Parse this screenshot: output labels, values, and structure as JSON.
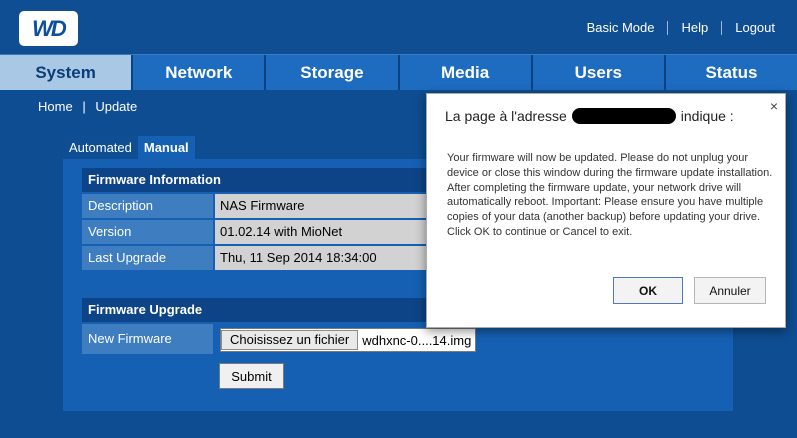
{
  "header": {
    "logo_text": "WD",
    "links": [
      "Basic Mode",
      "Help",
      "Logout"
    ]
  },
  "nav": {
    "tabs": [
      "System",
      "Network",
      "Storage",
      "Media",
      "Users",
      "Status"
    ],
    "active": "System"
  },
  "breadcrumb": {
    "home": "Home",
    "separator": "|",
    "current": "Update"
  },
  "subtabs": [
    "Automated",
    "Manual"
  ],
  "firmware_info": {
    "heading": "Firmware Information",
    "rows": [
      {
        "label": "Description",
        "value": "NAS Firmware"
      },
      {
        "label": "Version",
        "value": "01.02.14 with MioNet"
      },
      {
        "label": "Last Upgrade",
        "value": "Thu, 11 Sep 2014 18:34:00"
      }
    ]
  },
  "firmware_upgrade": {
    "heading": "Firmware Upgrade",
    "label": "New Firmware",
    "choose_file_label": "Choisissez un fichier",
    "file_name": "wdhxnc-0....14.img",
    "submit_label": "Submit"
  },
  "dialog": {
    "title_prefix": "La page à l'adresse",
    "title_suffix": "indique :",
    "close": "×",
    "message": "Your firmware will now be updated. Please do not unplug your device or close this window during the firmware update installation. After completing the firmware update, your network drive will automatically reboot. Important: Please ensure you have multiple copies of your data (another backup) before updating your drive. Click OK to continue or Cancel to exit.",
    "ok_label": "OK",
    "cancel_label": "Annuler"
  }
}
